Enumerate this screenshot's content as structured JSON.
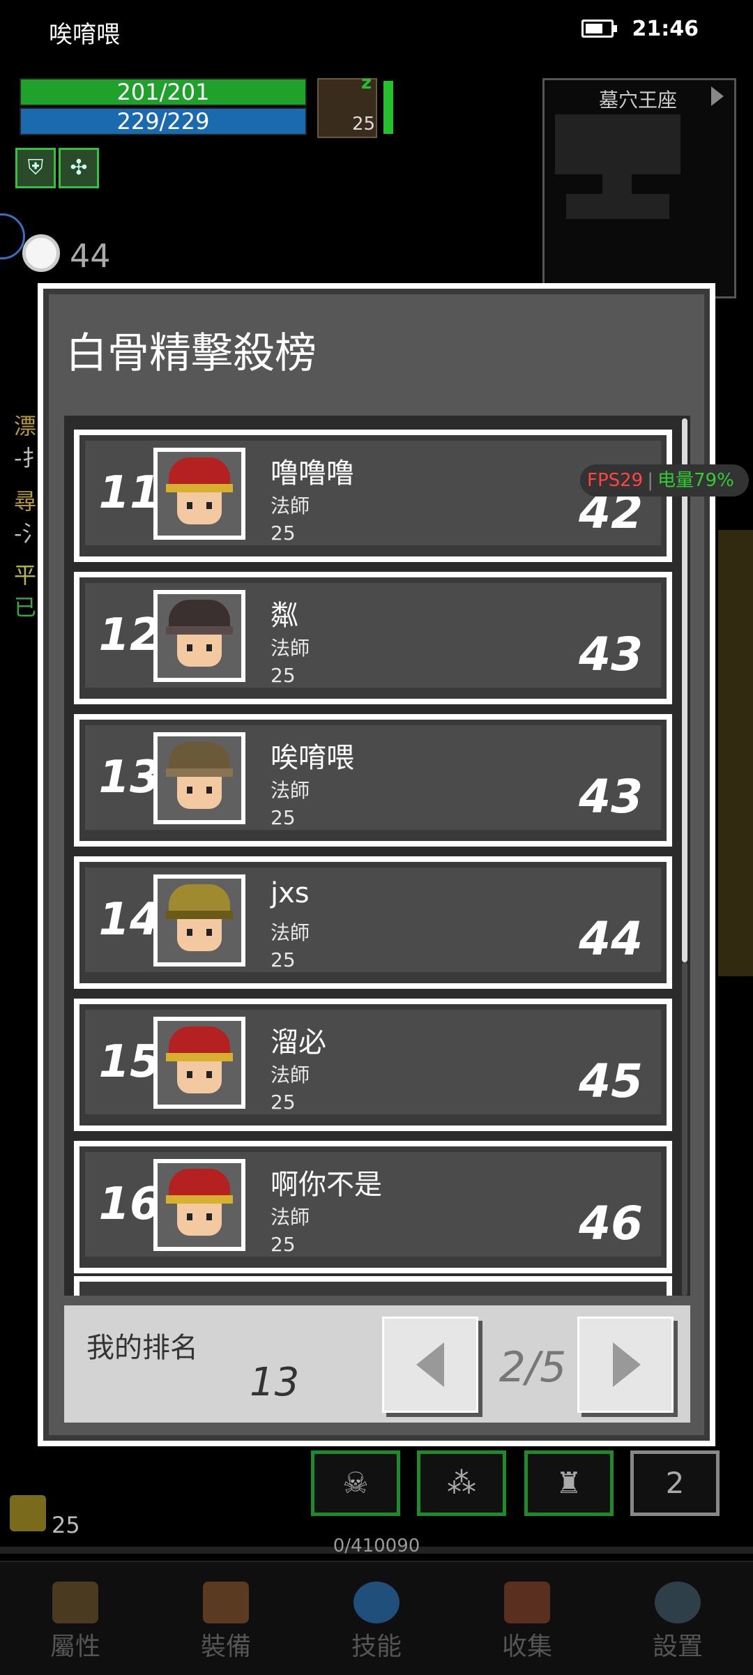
{
  "status_bar": {
    "title": "唉唷喂",
    "time": "21:46",
    "battery_pct": 70
  },
  "hud": {
    "hp": "201/201",
    "mp": "229/229",
    "level": "25",
    "turn_count": "44",
    "gold": "25",
    "xp_text": "0/410090",
    "slot_count": "2"
  },
  "minimap": {
    "title": "墓穴王座"
  },
  "side_log": [
    "漂",
    "-扌",
    "尋",
    "-氵",
    "平",
    "已"
  ],
  "leaderboard": {
    "title": "白骨精擊殺榜",
    "rows": [
      {
        "rank": "11",
        "name": "噜噜噜",
        "class": "法師",
        "level": "25",
        "kills": "42",
        "avatar": "red-hat-mage-face"
      },
      {
        "rank": "12",
        "name": "粼",
        "class": "法師",
        "level": "25",
        "kills": "43",
        "avatar": "dark-helmet-face"
      },
      {
        "rank": "13",
        "name": "唉唷喂",
        "class": "法師",
        "level": "25",
        "kills": "43",
        "avatar": "hooded-face"
      },
      {
        "rank": "14",
        "name": "jxs",
        "class": "法師",
        "level": "25",
        "kills": "44",
        "avatar": "golden-skull-helm-face"
      },
      {
        "rank": "15",
        "name": "溜必",
        "class": "法師",
        "level": "25",
        "kills": "45",
        "avatar": "red-hat-mage-face"
      },
      {
        "rank": "16",
        "name": "啊你不是",
        "class": "法師",
        "level": "25",
        "kills": "46",
        "avatar": "red-hat-mage-face"
      }
    ],
    "my_rank_label": "我的排名",
    "my_rank": "13",
    "page": "2/5"
  },
  "fps_overlay": {
    "fps": "FPS29",
    "battery": "电量79%"
  },
  "nav": [
    {
      "label": "屬性",
      "icon": "helmet-icon"
    },
    {
      "label": "裝備",
      "icon": "bag-icon"
    },
    {
      "label": "技能",
      "icon": "gem-icon"
    },
    {
      "label": "收集",
      "icon": "book-icon"
    },
    {
      "label": "設置",
      "icon": "gear-icon"
    }
  ],
  "colors": {
    "hp": "#1fa12b",
    "mp": "#1b6ab0",
    "dialog_bg": "#575757",
    "footer_bg": "#d3d3d3"
  }
}
